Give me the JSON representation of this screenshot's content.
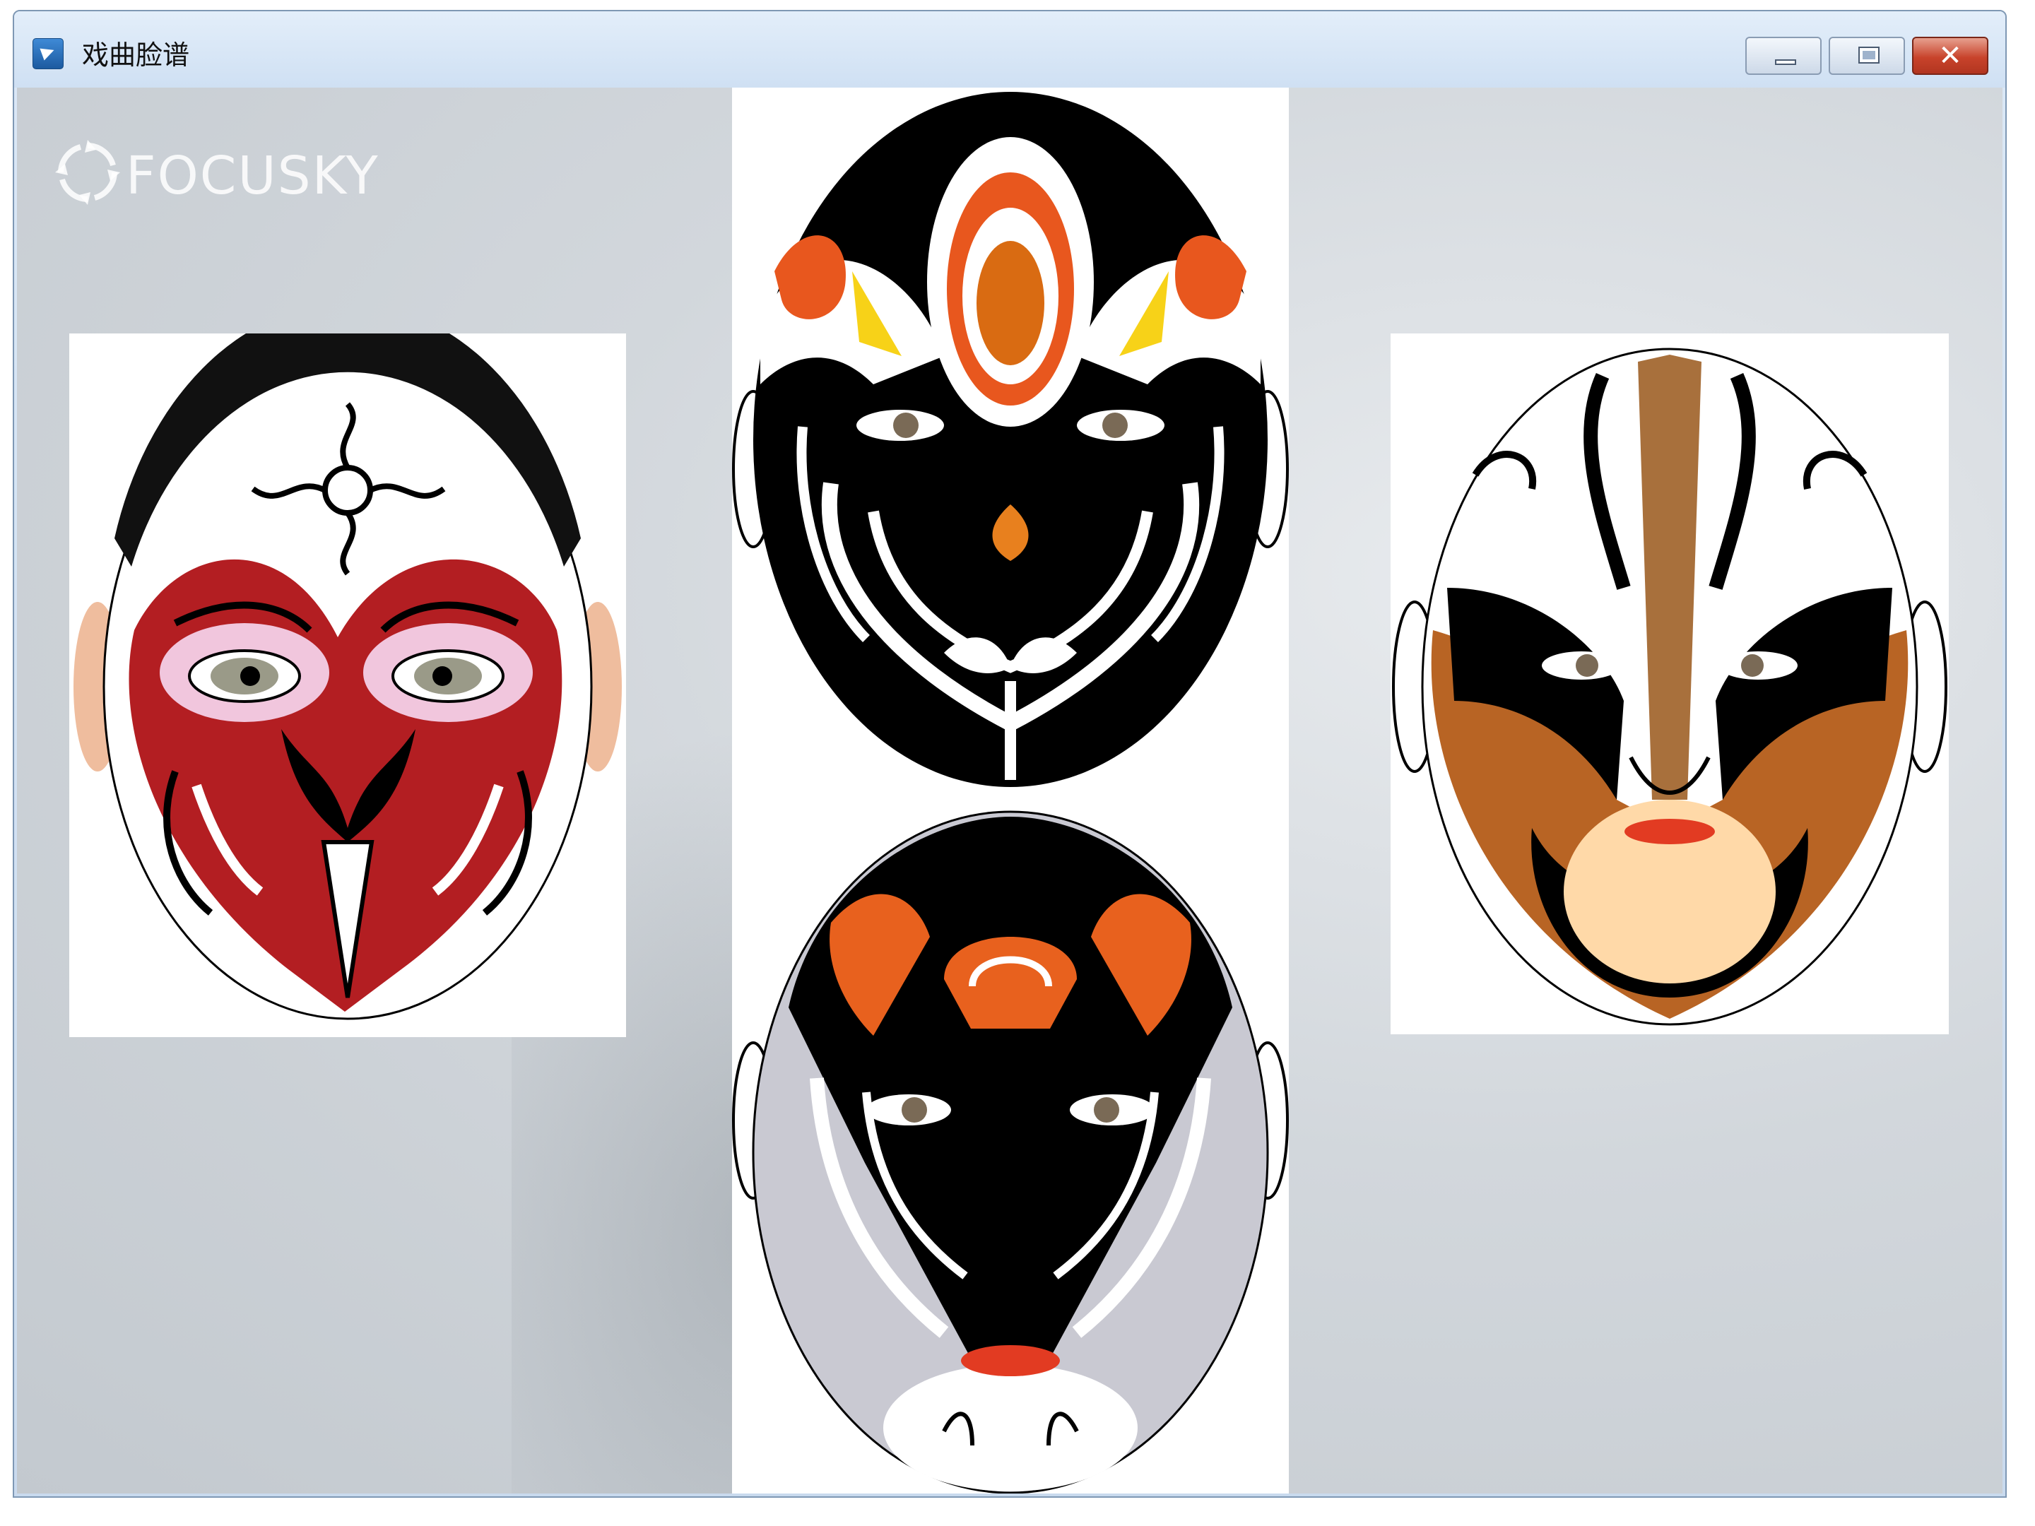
{
  "window": {
    "title": "戏曲脸谱",
    "app_icon": "app-icon",
    "controls": [
      "minimize",
      "maximize",
      "close"
    ]
  },
  "content": {
    "watermark": {
      "icon": "pinwheel-icon",
      "text": "FOCUSKY"
    },
    "images": [
      {
        "name": "red-monkey-mask",
        "colors": [
          "#b31e22",
          "#ffffff",
          "#000000",
          "#f1c6dd"
        ]
      },
      {
        "name": "black-orange-top-mask",
        "colors": [
          "#000000",
          "#ffffff",
          "#e8571e",
          "#f7d218"
        ]
      },
      {
        "name": "black-grey-bottom-mask",
        "colors": [
          "#000000",
          "#ffffff",
          "#e8611e",
          "#c9c9d2"
        ]
      },
      {
        "name": "brown-black-mask",
        "colors": [
          "#b86424",
          "#000000",
          "#ffffff",
          "#ffd9a8"
        ]
      }
    ]
  }
}
